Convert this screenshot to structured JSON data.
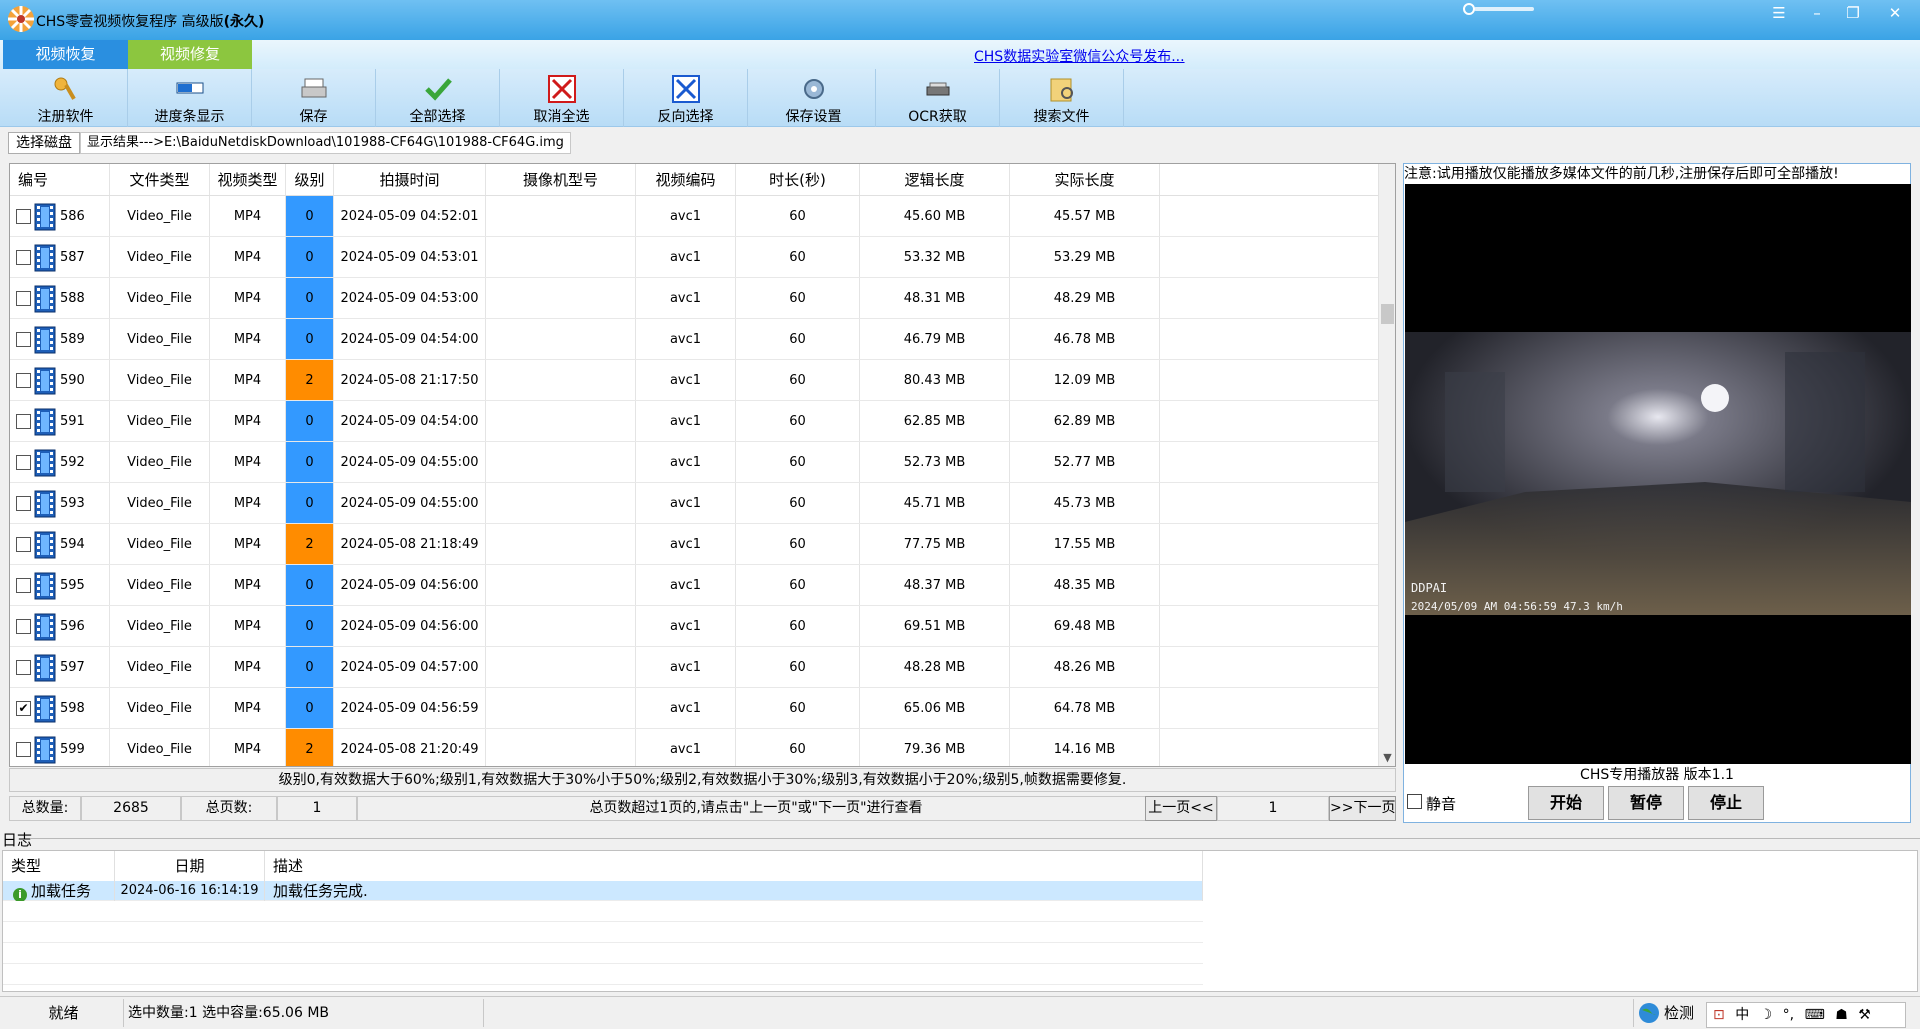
{
  "window": {
    "title": "CHS零壹视频恢复程序 高级版",
    "title_suffix": "(永久)"
  },
  "tabs": {
    "recover": "视频恢复",
    "repair": "视频修复"
  },
  "wechat_link": "CHS数据实验室微信公众号发布...",
  "toolbar": {
    "register": "注册软件",
    "progress": "进度条显示",
    "save": "保存",
    "select_all": "全部选择",
    "cancel_all": "取消全选",
    "invert": "反向选择",
    "save_settings": "保存设置",
    "ocr": "OCR获取",
    "search": "搜索文件"
  },
  "path_row": {
    "select_disk": "选择磁盘",
    "result": "显示结果--->E:\\BaiduNetdiskDownload\\101988-CF64G\\101988-CF64G.img"
  },
  "grid": {
    "columns": [
      "编号",
      "文件类型",
      "视频类型",
      "级别",
      "拍摄时间",
      "摄像机型号",
      "视频编码",
      "时长(秒)",
      "逻辑长度",
      "实际长度"
    ],
    "rows": [
      {
        "id": "586",
        "file_type": "Video_File",
        "video_type": "MP4",
        "level": "0",
        "time": "2024-05-09 04:52:01",
        "camera": "",
        "codec": "avc1",
        "duration": "60",
        "logical": "45.60 MB",
        "actual": "45.57 MB",
        "checked": false
      },
      {
        "id": "587",
        "file_type": "Video_File",
        "video_type": "MP4",
        "level": "0",
        "time": "2024-05-09 04:53:01",
        "camera": "",
        "codec": "avc1",
        "duration": "60",
        "logical": "53.32 MB",
        "actual": "53.29 MB",
        "checked": false
      },
      {
        "id": "588",
        "file_type": "Video_File",
        "video_type": "MP4",
        "level": "0",
        "time": "2024-05-09 04:53:00",
        "camera": "",
        "codec": "avc1",
        "duration": "60",
        "logical": "48.31 MB",
        "actual": "48.29 MB",
        "checked": false
      },
      {
        "id": "589",
        "file_type": "Video_File",
        "video_type": "MP4",
        "level": "0",
        "time": "2024-05-09 04:54:00",
        "camera": "",
        "codec": "avc1",
        "duration": "60",
        "logical": "46.79 MB",
        "actual": "46.78 MB",
        "checked": false
      },
      {
        "id": "590",
        "file_type": "Video_File",
        "video_type": "MP4",
        "level": "2",
        "time": "2024-05-08 21:17:50",
        "camera": "",
        "codec": "avc1",
        "duration": "60",
        "logical": "80.43 MB",
        "actual": "12.09 MB",
        "checked": false
      },
      {
        "id": "591",
        "file_type": "Video_File",
        "video_type": "MP4",
        "level": "0",
        "time": "2024-05-09 04:54:00",
        "camera": "",
        "codec": "avc1",
        "duration": "60",
        "logical": "62.85 MB",
        "actual": "62.89 MB",
        "checked": false
      },
      {
        "id": "592",
        "file_type": "Video_File",
        "video_type": "MP4",
        "level": "0",
        "time": "2024-05-09 04:55:00",
        "camera": "",
        "codec": "avc1",
        "duration": "60",
        "logical": "52.73 MB",
        "actual": "52.77 MB",
        "checked": false
      },
      {
        "id": "593",
        "file_type": "Video_File",
        "video_type": "MP4",
        "level": "0",
        "time": "2024-05-09 04:55:00",
        "camera": "",
        "codec": "avc1",
        "duration": "60",
        "logical": "45.71 MB",
        "actual": "45.73 MB",
        "checked": false
      },
      {
        "id": "594",
        "file_type": "Video_File",
        "video_type": "MP4",
        "level": "2",
        "time": "2024-05-08 21:18:49",
        "camera": "",
        "codec": "avc1",
        "duration": "60",
        "logical": "77.75 MB",
        "actual": "17.55 MB",
        "checked": false
      },
      {
        "id": "595",
        "file_type": "Video_File",
        "video_type": "MP4",
        "level": "0",
        "time": "2024-05-09 04:56:00",
        "camera": "",
        "codec": "avc1",
        "duration": "60",
        "logical": "48.37 MB",
        "actual": "48.35 MB",
        "checked": false
      },
      {
        "id": "596",
        "file_type": "Video_File",
        "video_type": "MP4",
        "level": "0",
        "time": "2024-05-09 04:56:00",
        "camera": "",
        "codec": "avc1",
        "duration": "60",
        "logical": "69.51 MB",
        "actual": "69.48 MB",
        "checked": false
      },
      {
        "id": "597",
        "file_type": "Video_File",
        "video_type": "MP4",
        "level": "0",
        "time": "2024-05-09 04:57:00",
        "camera": "",
        "codec": "avc1",
        "duration": "60",
        "logical": "48.28 MB",
        "actual": "48.26 MB",
        "checked": false
      },
      {
        "id": "598",
        "file_type": "Video_File",
        "video_type": "MP4",
        "level": "0",
        "time": "2024-05-09 04:56:59",
        "camera": "",
        "codec": "avc1",
        "duration": "60",
        "logical": "65.06 MB",
        "actual": "64.78 MB",
        "checked": true
      },
      {
        "id": "599",
        "file_type": "Video_File",
        "video_type": "MP4",
        "level": "2",
        "time": "2024-05-08 21:20:49",
        "camera": "",
        "codec": "avc1",
        "duration": "60",
        "logical": "79.36 MB",
        "actual": "14.16 MB",
        "checked": false
      }
    ]
  },
  "level_colors": {
    "0": "#3399ff",
    "2": "#ff8c00"
  },
  "legend": "级别0,有效数据大于60%;级别1,有效数据大于30%小于50%;级别2,有效数据小于30%;级别3,有效数据小于20%;级别5,帧数据需要修复.",
  "pager": {
    "total_label": "总数量:",
    "total": "2685",
    "pages_label": "总页数:",
    "pages": "1",
    "hint": "总页数超过1页的,请点击\"上一页\"或\"下一页\"进行查看",
    "prev": "上一页<<",
    "current": "1",
    "next": ">>下一页"
  },
  "player": {
    "note": "注意:试用播放仅能播放多媒体文件的前几秒,注册保存后即可全部播放!",
    "osd_brand": "DDPAI",
    "osd_text": "2024/05/09 AM 04:56:59 47.3 km/h",
    "version": "CHS专用播放器 版本1.1",
    "mute": "静音",
    "start": "开始",
    "pause": "暂停",
    "stop": "停止"
  },
  "log": {
    "caption": "日志",
    "columns": [
      "类型",
      "日期",
      "描述"
    ],
    "rows": [
      {
        "type": "加载任务",
        "date": "2024-06-16 16:14:19",
        "desc": "加载任务完成."
      }
    ]
  },
  "statusbar": {
    "ready": "就绪",
    "selection": "选中数量:1 选中容量:65.06 MB",
    "detect": "检测"
  },
  "ime": {
    "mode": "中"
  }
}
